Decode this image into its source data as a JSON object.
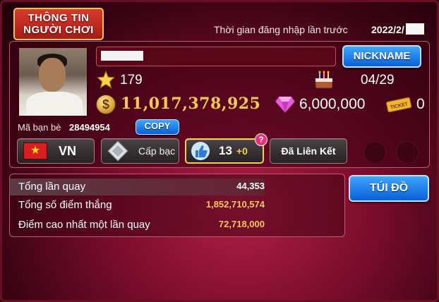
{
  "header": {
    "title_line1": "THÔNG TIN",
    "title_line2": "NGƯỜI CHƠI",
    "last_login_label": "Thời gian đăng nhập lần trước",
    "last_login_value": "2022/2/"
  },
  "profile": {
    "nickname_button": "NICKNAME",
    "level": "179",
    "birthday": "04/29",
    "coins": "11,017,378,925",
    "gems": "6,000,000",
    "tickets": "0",
    "ticket_icon_text": "TICKET",
    "friend_code_label": "Mã bạn bè",
    "friend_code_value": "28494954",
    "copy_button": "COPY"
  },
  "badges": {
    "country": "VN",
    "rank": "Cấp bạc",
    "likes": "13",
    "likes_plus": "+0",
    "help": "?",
    "linked": "Đã Liên Kết"
  },
  "stats": [
    {
      "label": "Tổng lần quay",
      "value": "44,353",
      "color": "#ffffff"
    },
    {
      "label": "Tổng số điểm thắng",
      "value": "1,852,710,574",
      "color": "#f6c85a"
    },
    {
      "label": "Điểm cao nhất một lần quay",
      "value": "72,718,000",
      "color": "#f6c85a"
    }
  ],
  "inventory_button": "TÚI ĐỒ",
  "colors": {
    "accent_gold": "#f6c85a",
    "button_blue": "#0a5fd6",
    "background": "#7c0d2d"
  },
  "icons": [
    "star-icon",
    "cake-icon",
    "coin-icon",
    "gem-icon",
    "ticket-icon",
    "flag-vn-icon",
    "diamond-icon",
    "thumbs-up-icon"
  ]
}
